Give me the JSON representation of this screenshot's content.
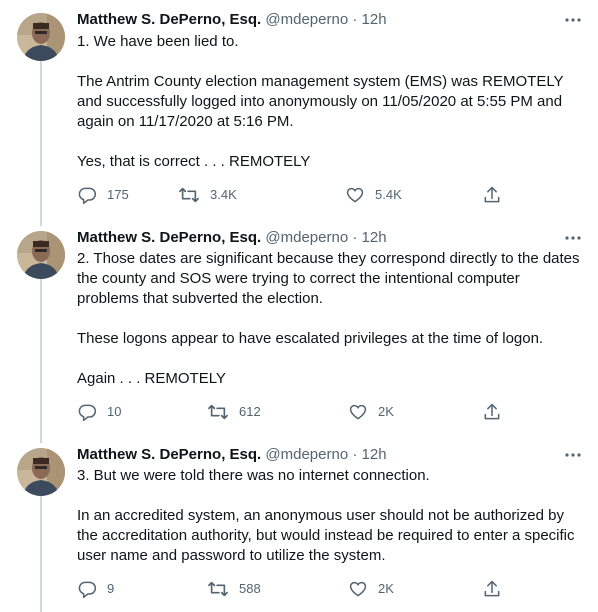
{
  "tweets": [
    {
      "name": "Matthew S. DePerno, Esq.",
      "handle": "@mdeperno",
      "separator": "·",
      "time": "12h",
      "lines": [
        "1. We have been lied to.",
        "",
        "The Antrim County election management system (EMS) was REMOTELY",
        "and successfully logged into anonymously on 11/05/2020 at 5:55 PM and",
        "again on 11/17/2020 at 5:16 PM.",
        "",
        "Yes, that is correct . . . REMOTELY"
      ],
      "replies": "175",
      "retweets": "3.4K",
      "likes": "5.4K"
    },
    {
      "name": "Matthew S. DePerno, Esq.",
      "handle": "@mdeperno",
      "separator": "·",
      "time": "12h",
      "lines": [
        "2. Those dates are significant because they correspond directly to the dates",
        "the county and SOS were trying to correct the intentional computer",
        "problems that subverted the election.",
        "",
        "These logons appear to have escalated privileges at the time of logon.",
        "",
        "Again . . . REMOTELY"
      ],
      "replies": "10",
      "retweets": "612",
      "likes": "2K"
    },
    {
      "name": "Matthew S. DePerno, Esq.",
      "handle": "@mdeperno",
      "separator": "·",
      "time": "12h",
      "lines": [
        "3. But we were told there was no internet connection.",
        "",
        "In an accredited system, an anonymous user should not be authorized by",
        "the accreditation authority, but would instead be required to enter a specific",
        "user name and password to utilize the system."
      ],
      "replies": "9",
      "retweets": "588",
      "likes": "2K"
    }
  ],
  "icons": {
    "reply": "reply-icon",
    "retweet": "retweet-icon",
    "like": "like-icon",
    "share": "share-icon",
    "more": "more-icon"
  },
  "colors": {
    "text": "#0f1419",
    "secondary": "#536471",
    "thread_line": "#cfd9de"
  }
}
